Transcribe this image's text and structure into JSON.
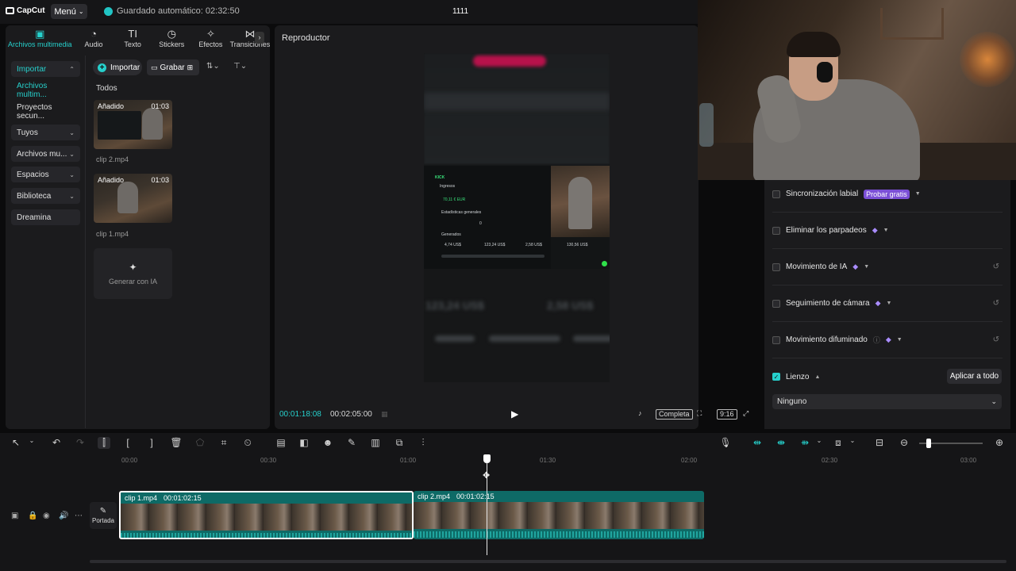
{
  "app": {
    "logo": "CapCut",
    "menu_label": "Menú",
    "autosave": "Guardado automático: 02:32:50",
    "project_title": "1111"
  },
  "media_tabs": [
    {
      "label": "Archivos multimedia",
      "icon": "media-icon"
    },
    {
      "label": "Audio",
      "icon": "audio-icon"
    },
    {
      "label": "Texto",
      "icon": "text-icon"
    },
    {
      "label": "Stickers",
      "icon": "stickers-icon"
    },
    {
      "label": "Efectos",
      "icon": "effects-icon"
    },
    {
      "label": "Transiciones",
      "icon": "transitions-icon"
    }
  ],
  "sidebar": {
    "items": [
      {
        "label": "Importar"
      },
      {
        "label": "Archivos multim..."
      },
      {
        "label": "Proyectos secun..."
      },
      {
        "label": "Tuyos"
      },
      {
        "label": "Archivos mu..."
      },
      {
        "label": "Espacios"
      },
      {
        "label": "Biblioteca"
      },
      {
        "label": "Dreamina"
      }
    ]
  },
  "media": {
    "import_label": "Importar",
    "record_label": "Grabar",
    "filter_label": "Todos",
    "items": [
      {
        "tag": "Añadido",
        "duration": "01:03",
        "name": "clip 2.mp4"
      },
      {
        "tag": "Añadido",
        "duration": "01:03",
        "name": "clip 1.mp4"
      }
    ],
    "generate_label": "Generar con IA"
  },
  "player": {
    "title": "Reproductor",
    "current_time": "00:01:18:08",
    "total_time": "00:02:05:00",
    "full_label": "Completa",
    "ratio_label": "9:16",
    "video": {
      "brand": "KICK",
      "section": "Ingresos",
      "amount": "70,11 € EUR",
      "stats_title": "Estadísticas generales",
      "stat_value": "0",
      "gen_title": "Generados",
      "values": [
        "4,74 US$",
        "123,24 US$",
        "2,58 US$",
        "130,56 US$"
      ],
      "blur_values": [
        "123,24 US$",
        "2,58 US$"
      ]
    }
  },
  "properties": {
    "rows": [
      {
        "label": "Sincronización labial",
        "badge": "Probar gratis"
      },
      {
        "label": "Eliminar los parpadeos"
      },
      {
        "label": "Movimiento de IA"
      },
      {
        "label": "Seguimiento de cámara"
      },
      {
        "label": "Movimiento difuminado"
      },
      {
        "label": "Lienzo"
      }
    ],
    "apply_all_label": "Aplicar a todo",
    "select_value": "Ninguno"
  },
  "timeline": {
    "ruler": [
      "00:00",
      "00:30",
      "01:00",
      "01:30",
      "02:00",
      "02:30",
      "03:00"
    ],
    "cover_label": "Portada",
    "clips": [
      {
        "name": "clip 1.mp4",
        "duration": "00:01:02:15"
      },
      {
        "name": "clip 2.mp4",
        "duration": "00:01:02:15"
      }
    ]
  },
  "colors": {
    "accent": "#26d0cc",
    "clip": "#0e6a66",
    "badge": "#7b4fd6",
    "panel": "#1b1b1d"
  }
}
